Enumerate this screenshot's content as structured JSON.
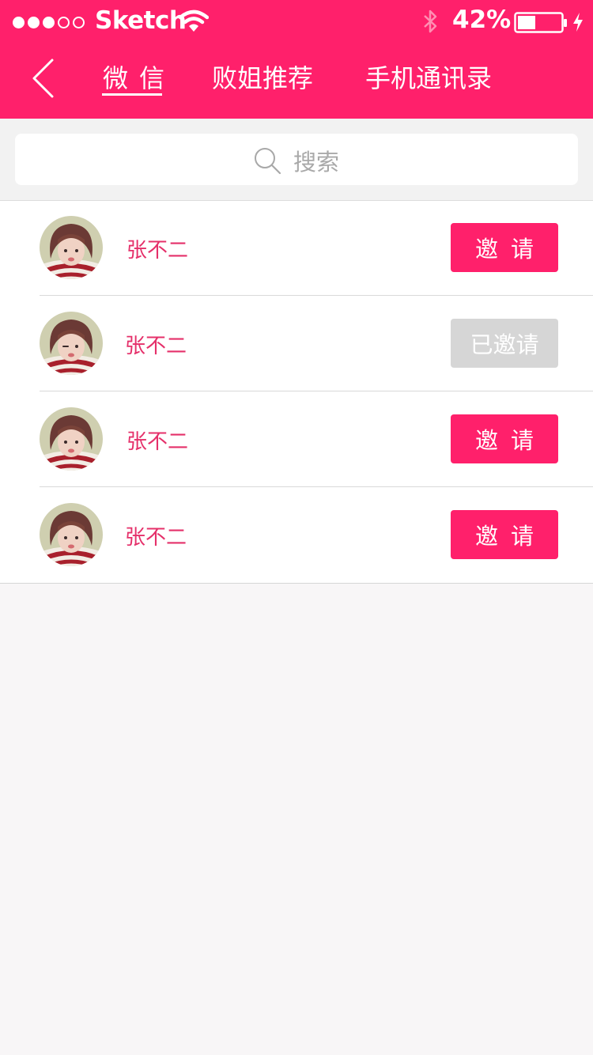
{
  "status_bar": {
    "carrier": "Sketch",
    "battery": "42%",
    "signal_bars_filled": 3,
    "signal_bars_total": 5,
    "battery_level": 0.42
  },
  "colors": {
    "brand": "#ff206b",
    "name_text": "#e5306a",
    "invited_button": "#d6d6d6",
    "page_bg": "#f8f6f7"
  },
  "nav": {
    "back_icon": "chevron-left-icon",
    "tabs": [
      {
        "label": "微信",
        "active": true
      },
      {
        "label": "败姐推荐",
        "active": false
      },
      {
        "label": "手机通讯录",
        "active": false
      }
    ]
  },
  "search": {
    "icon": "search-icon",
    "placeholder": "搜索"
  },
  "contacts": [
    {
      "name": "张不二",
      "button": "邀请",
      "invited": false
    },
    {
      "name": "张不二",
      "button": "已邀请",
      "invited": true
    },
    {
      "name": "张不二",
      "button": "邀请",
      "invited": false
    },
    {
      "name": "张不二",
      "button": "邀请",
      "invited": false
    }
  ]
}
